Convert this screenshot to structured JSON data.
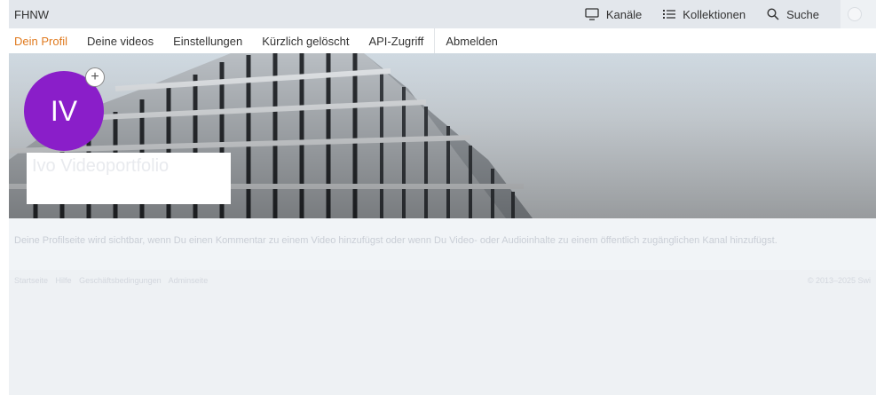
{
  "topbar": {
    "brand": "FHNW",
    "nav": [
      {
        "label": "Kanäle",
        "icon": "monitor-icon"
      },
      {
        "label": "Kollektionen",
        "icon": "list-icon"
      },
      {
        "label": "Suche",
        "icon": "search-icon"
      }
    ]
  },
  "tabs": [
    {
      "label": "Dein Profil",
      "active": true
    },
    {
      "label": "Deine videos",
      "active": false
    },
    {
      "label": "Einstellungen",
      "active": false
    },
    {
      "label": "Kürzlich gelöscht",
      "active": false
    },
    {
      "label": "API-Zugriff",
      "active": false
    },
    {
      "label": "Abmelden",
      "active": false
    }
  ],
  "profile": {
    "initials": "IV",
    "add_symbol": "+",
    "avatar_color": "#8a1ec9",
    "name": "Ivo Videoportfolio",
    "subtitle": ""
  },
  "info": {
    "text": "Deine Profilseite wird sichtbar, wenn Du einen Kommentar zu einem Video hinzufügst oder wenn Du Video- oder Audioinhalte zu einem öffentlich zugänglichen Kanal hinzufügst."
  },
  "footer": {
    "links": [
      "Startseite",
      "Hilfe",
      "Geschäftsbedingungen",
      "Adminseite"
    ],
    "copyright": "© 2013–2025 Swi"
  },
  "colors": {
    "accent": "#e07b20",
    "topbar_bg": "#e3e7ec"
  }
}
